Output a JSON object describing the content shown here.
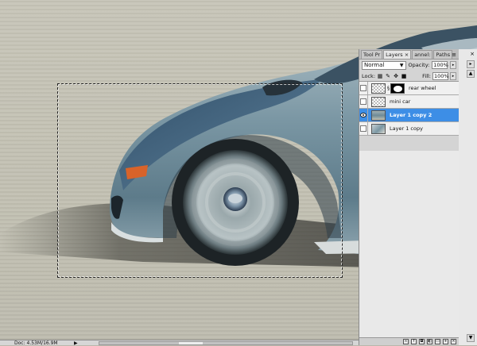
{
  "panel": {
    "tabs": [
      "Tool Pr",
      "Layers ×",
      "annel:",
      "Paths"
    ],
    "menu_icon": "panel-menu-icon",
    "blend_mode": "Normal",
    "opacity_label": "Opacity:",
    "opacity_value": "100%",
    "lock_label": "Lock:",
    "fill_label": "Fill:",
    "fill_value": "100%",
    "layers": [
      {
        "name": "rear wheel",
        "visible": false,
        "selected": false,
        "has_mask": true
      },
      {
        "name": "mini car",
        "visible": false,
        "selected": false,
        "has_mask": false
      },
      {
        "name": "Layer 1 copy 2",
        "visible": true,
        "selected": true,
        "has_mask": false
      },
      {
        "name": "Layer 1 copy",
        "visible": false,
        "selected": false,
        "has_mask": false
      }
    ],
    "selected_color": "#3d8ee6"
  },
  "status": {
    "doc_info": "Doc: 4.53M/16.9M",
    "nav_arrow": "▶"
  },
  "colors": {
    "panel_bg": "#d4d4d4",
    "canvas_bg": "#c3c1b3",
    "car_body": "#6f8c9a"
  }
}
